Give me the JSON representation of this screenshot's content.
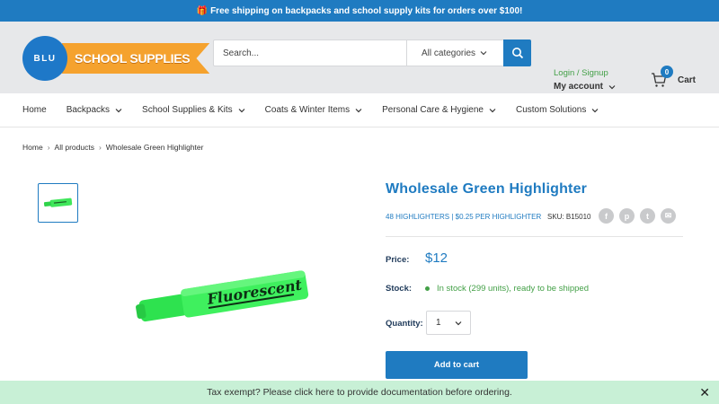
{
  "announcement": {
    "icon": "gift-icon",
    "text": "Free shipping on backpacks and school supply kits for orders over $100!"
  },
  "logo": {
    "circle_text": "BLU",
    "banner_text": "SCHOOL SUPPLIES",
    "colors": {
      "circle": "#1e78c8",
      "banner": "#f5a22e"
    }
  },
  "search": {
    "placeholder": "Search...",
    "category": "All categories"
  },
  "account": {
    "login": "Login / Signup",
    "my_account": "My account"
  },
  "cart": {
    "count": "0",
    "label": "Cart"
  },
  "nav": [
    {
      "label": "Home",
      "dropdown": false
    },
    {
      "label": "Backpacks",
      "dropdown": true
    },
    {
      "label": "School Supplies & Kits",
      "dropdown": true
    },
    {
      "label": "Coats & Winter Items",
      "dropdown": true
    },
    {
      "label": "Personal Care & Hygiene",
      "dropdown": true
    },
    {
      "label": "Custom Solutions",
      "dropdown": true
    }
  ],
  "breadcrumb": [
    "Home",
    "All products",
    "Wholesale Green Highlighter"
  ],
  "product": {
    "title": "Wholesale Green Highlighter",
    "subtitle": "48 HIGHLIGHTERS | $0.25 PER HIGHLIGHTER",
    "sku": "SKU: B15010",
    "price_label": "Price:",
    "price": "$12",
    "stock_label": "Stock:",
    "stock": "In stock (299 units), ready to be shipped",
    "qty_label": "Quantity:",
    "qty": "1",
    "add_to_cart": "Add to cart",
    "image_text": "Fluorescent"
  },
  "share_icons": [
    "facebook-icon",
    "pinterest-icon",
    "twitter-icon",
    "email-icon"
  ],
  "bottom_bar": {
    "text": "Tax exempt? Please click here to provide documentation before ordering."
  },
  "colors": {
    "primary": "#1f7bc1",
    "accent": "#f5a22e",
    "success": "#43a047",
    "notice_bg": "#c8f0d6"
  }
}
